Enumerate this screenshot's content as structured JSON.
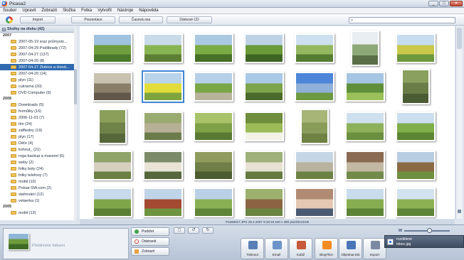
{
  "window": {
    "title": "Picasa2",
    "controls": [
      "_",
      "□",
      "✕"
    ]
  },
  "menu": [
    "Soubor",
    "Upravit",
    "Zobrazit",
    "Složka",
    "Fotka",
    "Vytvořit",
    "Nástroje",
    "Nápověda"
  ],
  "toolbar": {
    "import_label": "Import",
    "slideshow_label": "Prezentace",
    "timeline_label": "Časová osa",
    "cd_label": "Dárkové CD",
    "search_placeholder": ""
  },
  "sidebar": {
    "header": "Složky na disku (42)",
    "groups": [
      {
        "year": "2007",
        "folders": [
          {
            "name": "2007-05-19 sraz průmyslo...",
            "selected": false
          },
          {
            "name": "2007-04-29 Podlibrady (72)",
            "selected": false
          },
          {
            "name": "2007-04-27 (137)",
            "selected": false
          },
          {
            "name": "2007-04-20 (8)",
            "selected": false
          },
          {
            "name": "2007-04-27 Zlobice a Hond...",
            "selected": true
          },
          {
            "name": "2007-04-20 (14)",
            "selected": false
          },
          {
            "name": "plyn (11)",
            "selected": false
          },
          {
            "name": "cukrarna (20)",
            "selected": false
          },
          {
            "name": "DVD Computer (9)",
            "selected": false
          }
        ]
      },
      {
        "year": "2006",
        "folders": [
          {
            "name": "Downloads (5)",
            "selected": false
          },
          {
            "name": "formůlky (16)",
            "selected": false
          },
          {
            "name": "2006-11-01 (7)",
            "selected": false
          },
          {
            "name": "tím (24)",
            "selected": false
          },
          {
            "name": "zaffiedny (19)",
            "selected": false
          },
          {
            "name": "plyn (17)",
            "selected": false
          },
          {
            "name": "Děťe (4)",
            "selected": false
          },
          {
            "name": "kohout_ (21)",
            "selected": false
          },
          {
            "name": "roga backup a maxorel (6)",
            "selected": false
          },
          {
            "name": "weby (2)",
            "selected": false
          },
          {
            "name": "fotky boty (24)",
            "selected": false
          },
          {
            "name": "fotky telefony (7)",
            "selected": false
          },
          {
            "name": "mobil (10)",
            "selected": false
          },
          {
            "name": "Polsar-SW.com (2)",
            "selected": false
          },
          {
            "name": "stahování (12)",
            "selected": false
          },
          {
            "name": "vetaerka (1)",
            "selected": false
          }
        ]
      },
      {
        "year": "2005",
        "folders": [
          {
            "name": "mobil (13)",
            "selected": false
          }
        ]
      }
    ]
  },
  "photo_info": "P4260017.JPG    26.4.2007 9:18:19    640 x 480 pixel/3131KB",
  "tray": {
    "hint": "Přetáhněte fotkami",
    "actions": [
      {
        "label": "Podržet",
        "color": "#3fa34d"
      },
      {
        "label": "Odstranit",
        "color": "#d6412f"
      },
      {
        "label": "Zobrazit",
        "color": "#e8a23a"
      }
    ]
  },
  "bottom_actions": [
    {
      "label": "Tisknout",
      "color": "#5b7fb5"
    },
    {
      "label": "Email",
      "color": "#6d94c8"
    },
    {
      "label": "Koláž",
      "color": "#c7583a"
    },
    {
      "label": "BlogThis!",
      "color": "#f28b22"
    },
    {
      "label": "Objednat tisk",
      "color": "#4a74b8"
    },
    {
      "label": "Export",
      "color": "#7b8aa0"
    }
  ],
  "notification": {
    "line1": "rozdělené",
    "line2": "tobec.jpg"
  },
  "photos": [
    {
      "row": 0,
      "colors": [
        "#9fc2e0",
        "#6f9e3e",
        "#4c7a2b"
      ]
    },
    {
      "row": 0,
      "colors": [
        "#c9dbe9",
        "#89b452",
        "#5d7f35"
      ]
    },
    {
      "row": 0,
      "colors": [
        "#aac9e2",
        "#7aab45",
        "#466f27"
      ]
    },
    {
      "row": 0,
      "colors": [
        "#bcd3e6",
        "#6a9a3a",
        "#3f6522"
      ]
    },
    {
      "row": 0,
      "colors": [
        "#cde0ef",
        "#94b860",
        "#567c33"
      ]
    },
    {
      "row": 0,
      "colors": [
        "#e9eef3",
        "#8ea978",
        "#5a6f48"
      ]
    },
    {
      "row": 0,
      "colors": [
        "#c6dcf0",
        "#c9c84a",
        "#6e983e"
      ]
    },
    {
      "row": 1,
      "colors": [
        "#c8c2b0",
        "#8a7f69",
        "#61584a"
      ]
    },
    {
      "row": 1,
      "colors": [
        "#b9d3ea",
        "#e2dd3a",
        "#7ea43f"
      ]
    },
    {
      "row": 1,
      "colors": [
        "#b5d0e8",
        "#79a646",
        "#b9b39d"
      ]
    },
    {
      "row": 1,
      "colors": [
        "#a9c9e6",
        "#7ca44a",
        "#4a6b2d"
      ]
    },
    {
      "row": 1,
      "colors": [
        "#4d86d8",
        "#8fb0d8",
        "#6c9941"
      ]
    },
    {
      "row": 1,
      "colors": [
        "#a6c5e2",
        "#5f8f3a",
        "#9cc05a"
      ]
    },
    {
      "row": 1,
      "colors": [
        "#8aa05e",
        "#6a7d48",
        "#4b5b33"
      ]
    },
    {
      "row": 2,
      "colors": [
        "#8b9f5a",
        "#6f8248",
        "#56683a"
      ]
    },
    {
      "row": 2,
      "colors": [
        "#9aab72",
        "#b6b096",
        "#6b7c4a"
      ]
    },
    {
      "row": 2,
      "colors": [
        "#a8c36a",
        "#7ea046",
        "#5a7a33"
      ]
    },
    {
      "row": 2,
      "colors": [
        "#6f8d3c",
        "#9dbb56",
        "#f2f2e6"
      ]
    },
    {
      "row": 2,
      "colors": [
        "#a7b577",
        "#8a9c5a",
        "#6f8243"
      ]
    },
    {
      "row": 2,
      "colors": [
        "#cfe0ee",
        "#8db05a",
        "#6a8f3f"
      ]
    },
    {
      "row": 2,
      "colors": [
        "#cbdfef",
        "#7fae4a",
        "#5b8433"
      ]
    },
    {
      "row": 3,
      "colors": [
        "#8ea468",
        "#d6d0bf",
        "#6b8042"
      ]
    },
    {
      "row": 3,
      "colors": [
        "#7b8b6a",
        "#e9e4d6",
        "#55673b"
      ]
    },
    {
      "row": 3,
      "colors": [
        "#8f9c5d",
        "#6f7f47",
        "#4d5c31"
      ]
    },
    {
      "row": 3,
      "colors": [
        "#9fb07a",
        "#e6e1d2",
        "#667a40"
      ]
    },
    {
      "row": 3,
      "colors": [
        "#c5d6e6",
        "#b9b29f",
        "#6c8242"
      ]
    },
    {
      "row": 3,
      "colors": [
        "#8a6a52",
        "#c3b8a2",
        "#728b4a"
      ]
    },
    {
      "row": 3,
      "colors": [
        "#b8cde2",
        "#8a6a45",
        "#6f9040"
      ]
    },
    {
      "row": 4,
      "colors": [
        "#c7dbed",
        "#7fa64a",
        "#5a7f35"
      ]
    },
    {
      "row": 4,
      "colors": [
        "#c0d4e8",
        "#a44a32",
        "#6f9441"
      ]
    },
    {
      "row": 4,
      "colors": [
        "#b9d0e6",
        "#8ab054",
        "#5f8538"
      ]
    },
    {
      "row": 4,
      "colors": [
        "#9eb06e",
        "#8b6443",
        "#6a8542"
      ]
    },
    {
      "row": 4,
      "colors": [
        "#b08a72",
        "#e4c8b3",
        "#4a5a72"
      ]
    },
    {
      "row": 4,
      "colors": [
        "#c9dcec",
        "#86ad50",
        "#5c8437"
      ]
    },
    {
      "row": 4,
      "colors": [
        "#d3e2ef",
        "#8cb153",
        "#5e8538"
      ]
    }
  ]
}
